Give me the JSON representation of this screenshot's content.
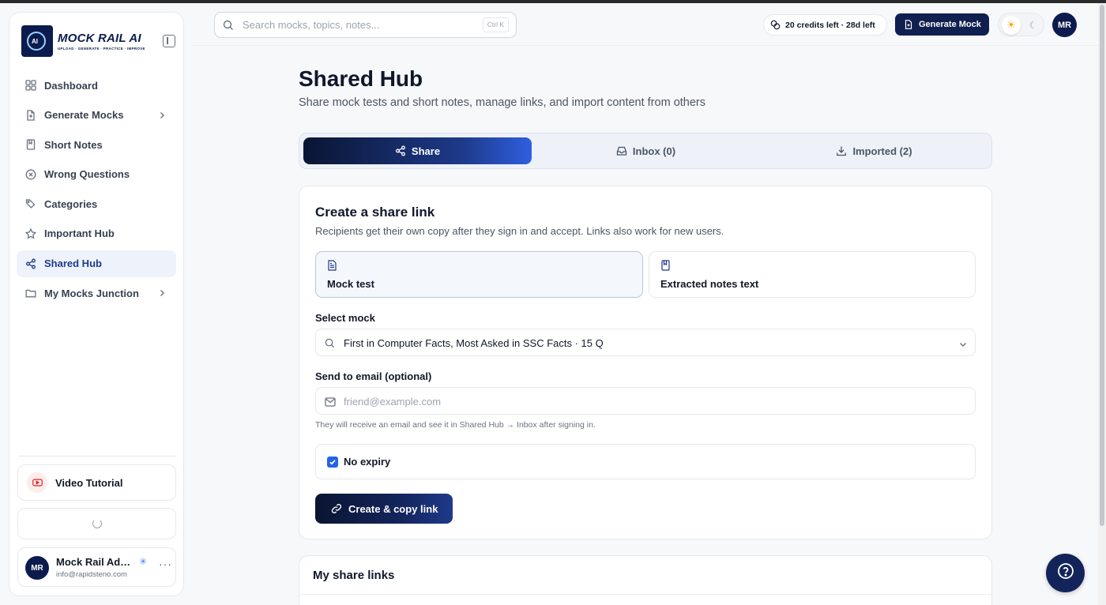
{
  "sidebar": {
    "brand": "MOCK RAIL AI",
    "tagline": "UPLOAD · GENERATE · PRACTICE · IMPROVE",
    "logo_badge": "AI",
    "nav": [
      {
        "label": "Dashboard",
        "icon": "grid-icon"
      },
      {
        "label": "Generate Mocks",
        "icon": "file-icon",
        "has_submenu": true
      },
      {
        "label": "Short Notes",
        "icon": "notebook-icon"
      },
      {
        "label": "Wrong Questions",
        "icon": "x-circle-icon"
      },
      {
        "label": "Categories",
        "icon": "tags-icon"
      },
      {
        "label": "Important Hub",
        "icon": "star-icon"
      },
      {
        "label": "Shared Hub",
        "icon": "share-icon",
        "active": true
      },
      {
        "label": "My Mocks Junction",
        "icon": "folder-icon",
        "has_submenu": true
      }
    ],
    "video_tutorial": "Video Tutorial",
    "user": {
      "initials": "MR",
      "name": "Mock Rail Admin",
      "email": "info@rapidsteno.com"
    }
  },
  "topbar": {
    "search_placeholder": "Search mocks, topics, notes...",
    "search_shortcut": "Ctrl K",
    "credits": "20 credits left · 28d left",
    "generate_label": "Generate Mock",
    "avatar_initials": "MR"
  },
  "page": {
    "title": "Shared Hub",
    "subtitle": "Share mock tests and short notes, manage links, and import content from others"
  },
  "tabs": [
    {
      "label": "Share",
      "active": true
    },
    {
      "label": "Inbox (0)"
    },
    {
      "label": "Imported (2)"
    }
  ],
  "share_form": {
    "title": "Create a share link",
    "description": "Recipients get their own copy after they sign in and accept. Links also work for new users.",
    "types": [
      {
        "label": "Mock test",
        "selected": true
      },
      {
        "label": "Extracted notes text"
      }
    ],
    "select_label": "Select mock",
    "select_value": "First in Computer Facts, Most Asked in SSC Facts · 15 Q",
    "email_label": "Send to email (optional)",
    "email_placeholder": "friend@example.com",
    "email_hint": "They will receive an email and see it in Shared Hub → Inbox after signing in.",
    "no_expiry_label": "No expiry",
    "no_expiry_checked": true,
    "cta_label": "Create & copy link"
  },
  "links_section": {
    "title": "My share links"
  },
  "colors": {
    "accent": "#1e3a8a",
    "navy": "#0b1b4d",
    "checkbox": "#2563eb"
  }
}
